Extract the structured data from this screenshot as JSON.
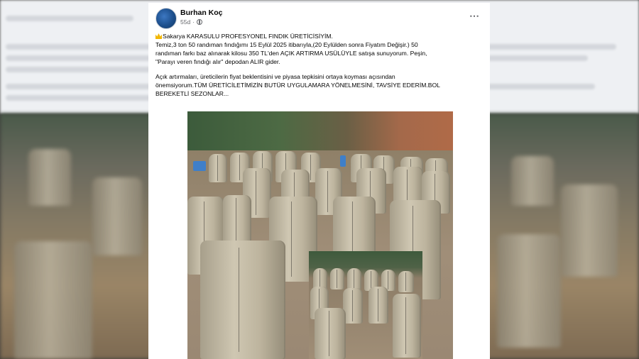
{
  "post": {
    "author": "Burhan Koç",
    "time": "55d",
    "more_icon": "⋯",
    "paragraph1": {
      "line1": "Sakarya  KARASULU PROFESYONEL FINDIK ÜRETİCİSİYİM.",
      "line2": "Temiz,3 ton 50 randıman  fındığımı 15 Eylül 2025 itibarıyla,(20 Eylülden sonra Fiyatım Değişir.) 50",
      "line3": "randıman farkı baz alınarak kilosu 350 TL'den AÇIK ARTIRMA USÜLÜYLE  satışa sunuyorum. Peşin,",
      "line4": "\"Parayı veren fındığı alır\" depodan ALIR gider."
    },
    "paragraph2": {
      "line1": "Açık artırmaları, üreticilerin fiyat beklentisini ve piyasa tepkisini ortaya koyması açısından",
      "line2": "önemsiyorum.TÜM ÜRETİCİLETİMİZİN BUTÜR UYGULAMARA YÖNELMESİNİ, TAVSİYE EDERİM.BOL",
      "line3": "BEREKETLİ SEZONLAR..."
    }
  },
  "icons": {
    "avatar": "avatar-icon",
    "globe": "globe-icon",
    "crown": "crown-emoji-icon",
    "more": "more-options-icon"
  },
  "colors": {
    "text": "#050505",
    "secondary": "#65676b",
    "card": "#ffffff"
  }
}
